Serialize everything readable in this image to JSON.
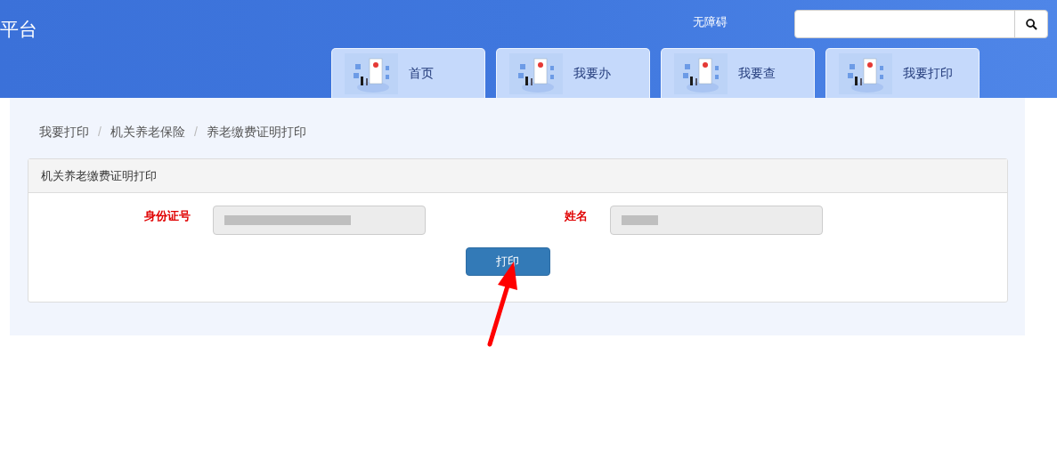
{
  "header": {
    "site_title": "平台",
    "accessibility_link": "无障碍"
  },
  "nav_tabs": [
    {
      "label": "首页",
      "selected": false
    },
    {
      "label": "我要办",
      "selected": false
    },
    {
      "label": "我要查",
      "selected": false
    },
    {
      "label": "我要打印",
      "selected": false
    }
  ],
  "breadcrumb": {
    "separator": "/",
    "items": [
      "我要打印",
      "机关养老保险",
      "养老缴费证明打印"
    ]
  },
  "panel": {
    "title": "机关养老缴费证明打印",
    "fields": [
      {
        "label": "身份证号",
        "required": true,
        "disabled": true,
        "redacted": true
      },
      {
        "label": "姓名",
        "required": true,
        "disabled": true,
        "redacted": true
      }
    ],
    "button": "打印"
  }
}
